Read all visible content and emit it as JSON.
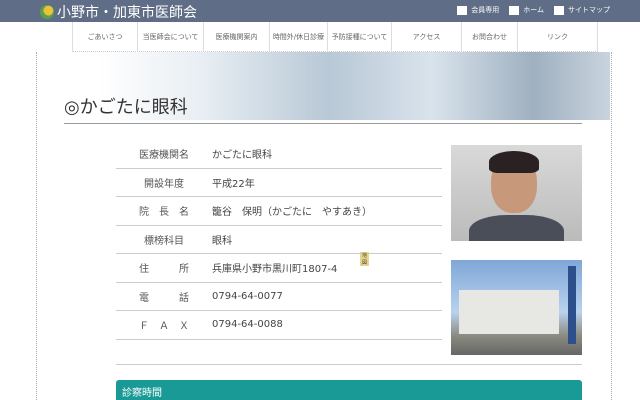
{
  "header": {
    "site_title": "小野市・加東市医師会",
    "links": [
      {
        "label": "会員専用",
        "icon": "member-card-icon"
      },
      {
        "label": "ホーム",
        "icon": "home-icon"
      },
      {
        "label": "サイトマップ",
        "icon": "sitemap-icon"
      }
    ]
  },
  "nav": [
    "ごあいさつ",
    "当医師会について",
    "医療機関案内",
    "時間外/休日診療",
    "予防接種について",
    "アクセス",
    "お問合わせ",
    "リンク"
  ],
  "page": {
    "title": "◎かごたに眼科",
    "info": [
      {
        "k": "医療機関名",
        "v": "かごたに眼科"
      },
      {
        "k": "開設年度",
        "v": "平成22年"
      },
      {
        "k": "院　長　名",
        "v": "籠谷　保明（かごたに　やすあき）"
      },
      {
        "k": "標榜科目",
        "v": "眼科"
      },
      {
        "k": "住　　　所",
        "v": "兵庫県小野市黒川町1807-4"
      },
      {
        "k": "電　　　話",
        "v": "0794-64-0077"
      },
      {
        "k": "Ｆ　Ａ　Ｘ",
        "v": "0794-64-0088"
      }
    ],
    "map_badge": "地図",
    "hours_heading": "診察時間"
  },
  "colors": {
    "header": "#5f6e86",
    "accent": "#1a9a96"
  }
}
